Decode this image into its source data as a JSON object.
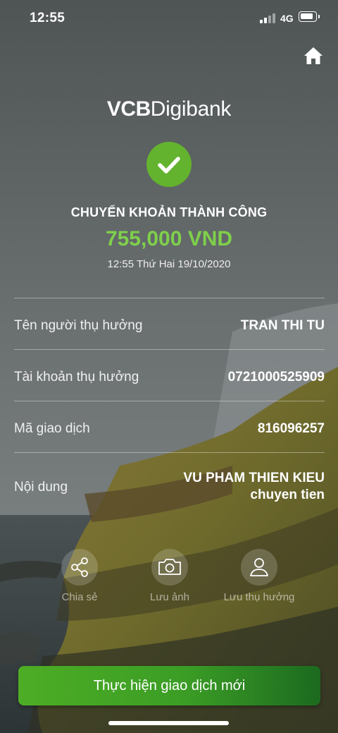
{
  "status_bar": {
    "time": "12:55",
    "network": "4G"
  },
  "brand": {
    "part1": "VCB",
    "part2": "Digibank"
  },
  "transfer": {
    "title": "CHUYỂN KHOẢN THÀNH CÔNG",
    "amount": "755,000 VND",
    "datetime": "12:55 Thứ Hai 19/10/2020"
  },
  "details": [
    {
      "label": "Tên người thụ hưởng",
      "value": "TRAN THI TU"
    },
    {
      "label": "Tài khoản thụ hưởng",
      "value": "0721000525909"
    },
    {
      "label": "Mã giao dịch",
      "value": "816096257"
    },
    {
      "label": "Nội dung",
      "value_line1": "VU PHAM THIEN KIEU",
      "value_line2": "chuyen tien"
    }
  ],
  "actions": {
    "share": {
      "label": "Chia sẻ",
      "icon": "share-icon"
    },
    "save_photo": {
      "label": "Lưu ảnh",
      "icon": "camera-icon"
    },
    "save_beneficiary": {
      "label": "Lưu thụ hưởng",
      "icon": "user-icon"
    }
  },
  "cta": {
    "label": "Thực hiện giao dịch mới"
  },
  "colors": {
    "accent_green": "#63b32e",
    "amount_green": "#7ed04b",
    "button_green": "#3b9d25"
  }
}
